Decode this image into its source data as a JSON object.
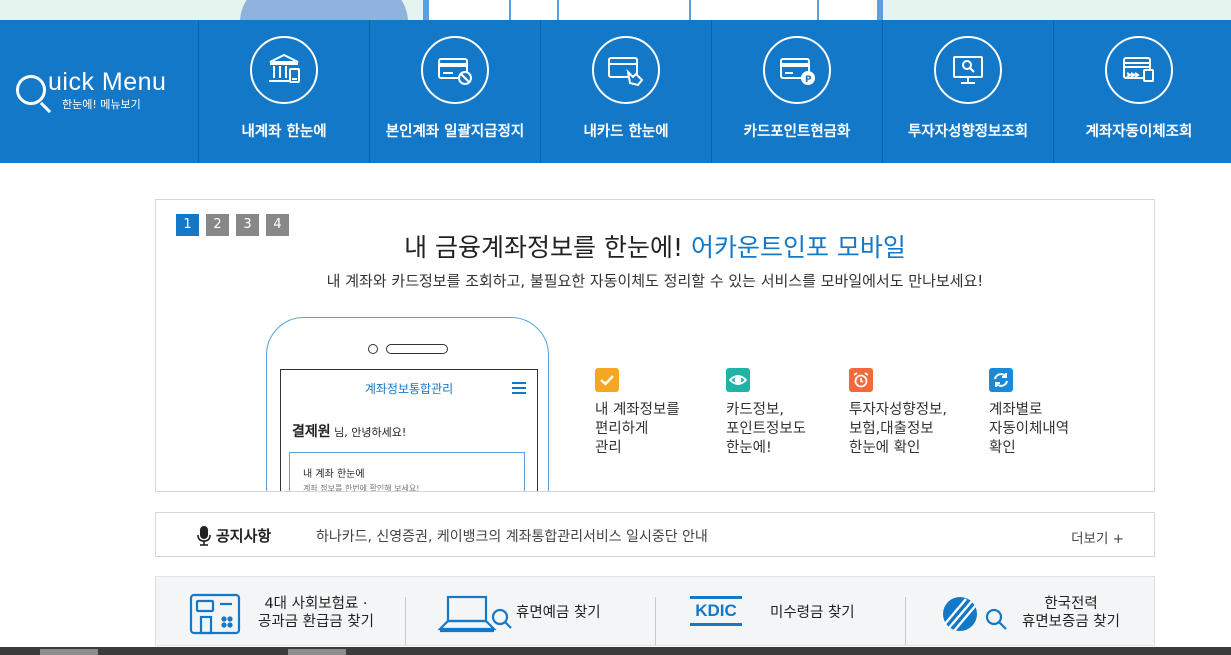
{
  "quick_menu": {
    "title": "uick Menu",
    "subtitle": "한눈에! 메뉴보기",
    "items": [
      {
        "label": "내계좌 한눈에",
        "icon": "bank-icon"
      },
      {
        "label": "본인계좌 일괄지급정지",
        "icon": "card-block-icon"
      },
      {
        "label": "내카드 한눈에",
        "icon": "card-hand-icon"
      },
      {
        "label": "카드포인트현금화",
        "icon": "card-point-icon"
      },
      {
        "label": "투자자성향정보조회",
        "icon": "monitor-search-icon"
      },
      {
        "label": "계좌자동이체조회",
        "icon": "auto-transfer-icon"
      }
    ]
  },
  "banner": {
    "pages": [
      "1",
      "2",
      "3",
      "4"
    ],
    "active_page": 1,
    "title_main": "내 금융계좌정보를 한눈에! ",
    "title_accent": "어카운트인포 모바일",
    "subtitle": "내 계좌와 카드정보를 조회하고, 불필요한 자동이체도 정리할 수 있는 서비스를 모바일에서도 만나보세요!",
    "phone": {
      "screen_title": "계좌정보통합관리",
      "user_name": "결제원",
      "greeting": " 님, 안녕하세요!",
      "card_title": "내 계좌 한눈에",
      "card_desc": "계좌 정보를 한번에 확인해 보세요!"
    },
    "features": [
      {
        "text": "내 계좌정보를\n편리하게\n관리",
        "icon": "check-icon",
        "color": "#f5a623"
      },
      {
        "text": "카드정보,\n포인트정보도\n한눈에!",
        "icon": "eye-icon",
        "color": "#1fb3a6"
      },
      {
        "text": "투자자성향정보,\n보험,대출정보\n한눈에 확인",
        "icon": "alarm-icon",
        "color": "#f06a3c"
      },
      {
        "text": "계좌별로\n자동이체내역\n확인",
        "icon": "refresh-icon",
        "color": "#1a8ad6"
      }
    ]
  },
  "notice": {
    "label": "공지사항",
    "text": "하나카드, 신영증권, 케이뱅크의 계좌통합관리서비스 일시중단 안내",
    "more": "더보기 +"
  },
  "services": [
    {
      "text": "4대 사회보험료 ·\n공과금 환급금 찾기",
      "icon": "bill-refund-icon"
    },
    {
      "text": "휴면예금 찾기",
      "icon": "laptop-search-icon"
    },
    {
      "logo": "KDIC",
      "text": "미수령금 찾기",
      "icon": "kdic-logo-icon"
    },
    {
      "text": "한국전력\n휴면보증금 찾기",
      "icon": "kepco-search-icon"
    }
  ],
  "colors": {
    "primary": "#1478c8",
    "background": "#ffffff",
    "border": "#d6d6d6"
  }
}
